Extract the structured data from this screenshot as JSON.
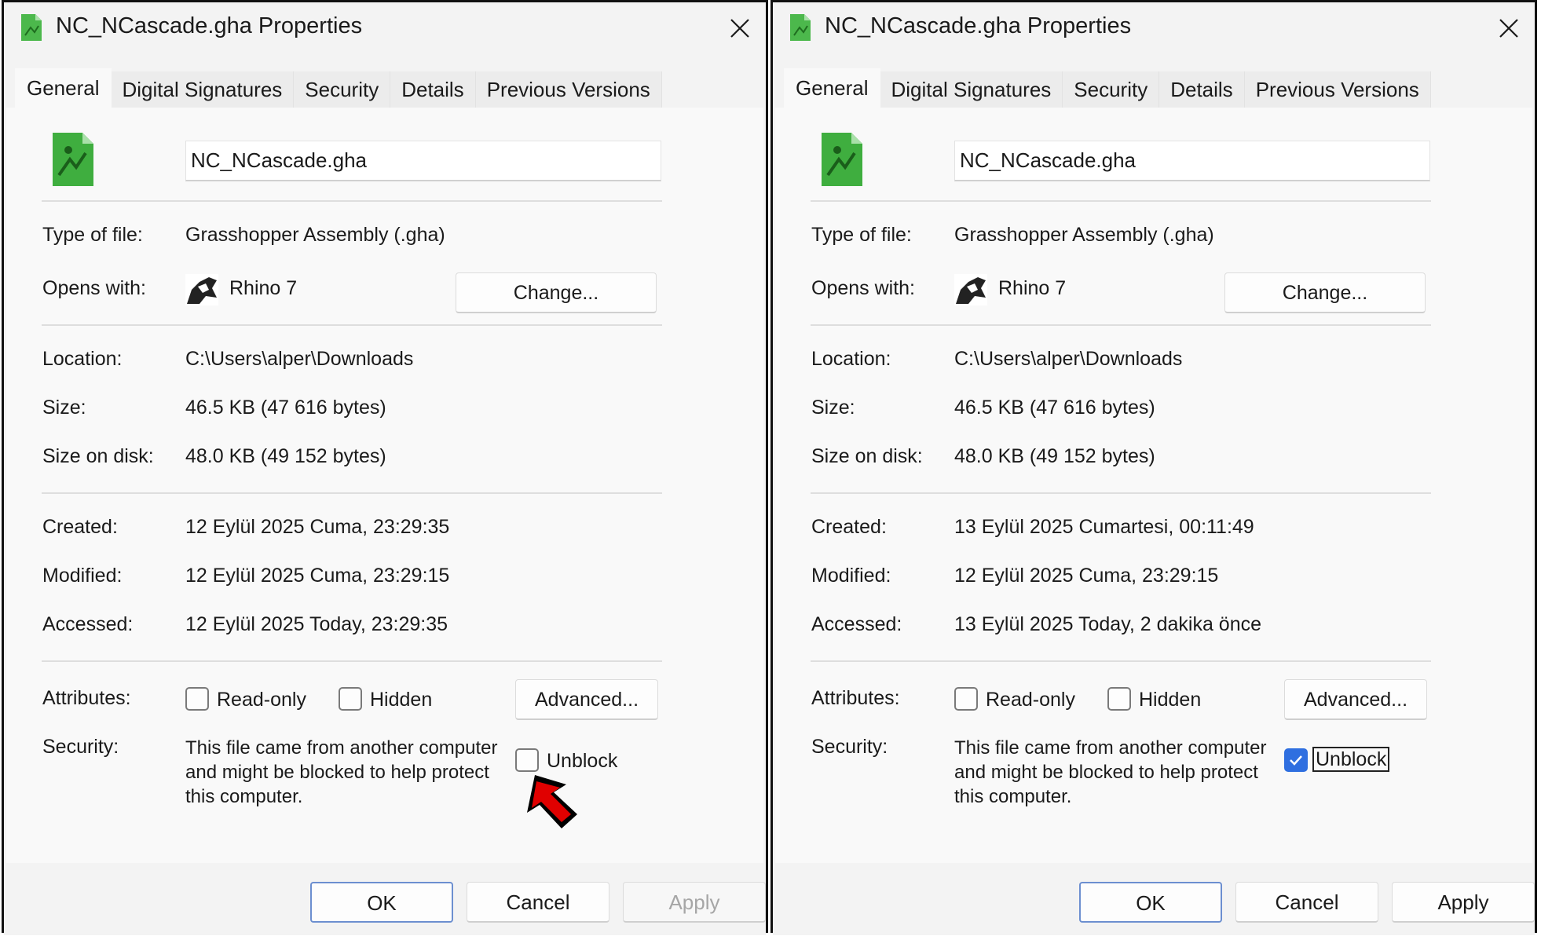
{
  "dialogs": [
    {
      "title": "NC_NCascade.gha Properties",
      "tabs": [
        "General",
        "Digital Signatures",
        "Security",
        "Details",
        "Previous Versions"
      ],
      "active_tab": "General",
      "file_name": "NC_NCascade.gha",
      "type_of_file_label": "Type of file:",
      "type_of_file": "Grasshopper Assembly (.gha)",
      "opens_with_label": "Opens with:",
      "opens_with": "Rhino 7",
      "change_button": "Change...",
      "location_label": "Location:",
      "location": "C:\\Users\\alper\\Downloads",
      "size_label": "Size:",
      "size": "46.5 KB (47 616 bytes)",
      "size_on_disk_label": "Size on disk:",
      "size_on_disk": "48.0 KB (49 152 bytes)",
      "created_label": "Created:",
      "created": "12 Eylül 2025 Cuma, 23:29:35",
      "modified_label": "Modified:",
      "modified": "12 Eylül 2025 Cuma, 23:29:15",
      "accessed_label": "Accessed:",
      "accessed": "12 Eylül 2025 Today, 23:29:35",
      "attributes_label": "Attributes:",
      "readonly_label": "Read-only",
      "readonly_checked": false,
      "hidden_label": "Hidden",
      "hidden_checked": false,
      "advanced_button": "Advanced...",
      "security_label": "Security:",
      "security_text": "This file came from another computer and might be blocked to help protect this computer.",
      "unblock_label": "Unblock",
      "unblock_checked": false,
      "ok_button": "OK",
      "cancel_button": "Cancel",
      "apply_button": "Apply",
      "apply_enabled": false
    },
    {
      "title": "NC_NCascade.gha Properties",
      "tabs": [
        "General",
        "Digital Signatures",
        "Security",
        "Details",
        "Previous Versions"
      ],
      "active_tab": "General",
      "file_name": "NC_NCascade.gha",
      "type_of_file_label": "Type of file:",
      "type_of_file": "Grasshopper Assembly (.gha)",
      "opens_with_label": "Opens with:",
      "opens_with": "Rhino 7",
      "change_button": "Change...",
      "location_label": "Location:",
      "location": "C:\\Users\\alper\\Downloads",
      "size_label": "Size:",
      "size": "46.5 KB (47 616 bytes)",
      "size_on_disk_label": "Size on disk:",
      "size_on_disk": "48.0 KB (49 152 bytes)",
      "created_label": "Created:",
      "created": "13 Eylül 2025 Cumartesi, 00:11:49",
      "modified_label": "Modified:",
      "modified": "12 Eylül 2025 Cuma, 23:29:15",
      "accessed_label": "Accessed:",
      "accessed": "13 Eylül 2025 Today, 2 dakika önce",
      "attributes_label": "Attributes:",
      "readonly_label": "Read-only",
      "readonly_checked": false,
      "hidden_label": "Hidden",
      "hidden_checked": false,
      "advanced_button": "Advanced...",
      "security_label": "Security:",
      "security_text": "This file came from another computer and might be blocked to help protect this computer.",
      "unblock_label": "Unblock",
      "unblock_checked": true,
      "ok_button": "OK",
      "cancel_button": "Cancel",
      "apply_button": "Apply",
      "apply_enabled": true
    }
  ],
  "annotation": {
    "arrow_color": "#e00000",
    "arrow_icon": "red-arrow-pointing-to-unblock"
  },
  "colors": {
    "accent": "#2f6fe0",
    "file_icon_green": "#3fae3f"
  }
}
